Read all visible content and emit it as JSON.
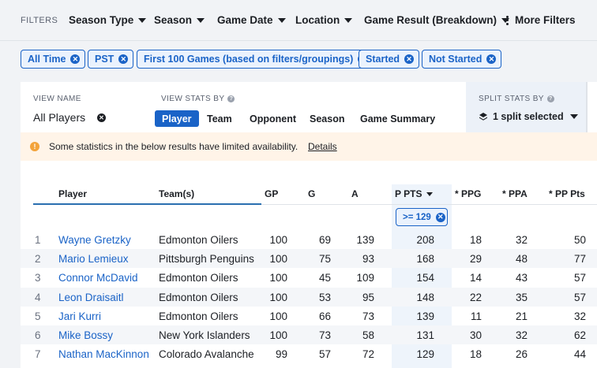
{
  "filterbar": {
    "label": "FILTERS",
    "dropdowns": [
      "Season Type",
      "Season",
      "Game Date",
      "Location",
      "Game Result (Breakdown)"
    ],
    "more": "More Filters"
  },
  "chips": [
    "All Time",
    "PST",
    "First 100 Games (based on filters/groupings)",
    "Started",
    "Not Started"
  ],
  "view": {
    "name_label": "VIEW NAME",
    "name": "All Players",
    "stats_label": "VIEW STATS BY",
    "tabs": [
      "Player",
      "Team",
      "Opponent",
      "Season",
      "Game Summary"
    ],
    "active_tab": "Player"
  },
  "split": {
    "label": "SPLIT STATS BY",
    "value": "1 split selected"
  },
  "notice": {
    "text": "Some statistics in the below results have limited availability.",
    "link": "Details"
  },
  "table": {
    "columns": [
      "Player",
      "Team(s)",
      "GP",
      "G",
      "A",
      "P PTS",
      "* PPG",
      "* PPA",
      "* PP Pts"
    ],
    "sort_column": "P PTS",
    "column_filter": ">= 129",
    "rows": [
      {
        "rank": "1",
        "player": "Wayne Gretzky",
        "team": "Edmonton Oilers",
        "gp": "100",
        "g": "69",
        "a": "139",
        "pts": "208",
        "ppg": "18",
        "ppa": "32",
        "pppts": "50"
      },
      {
        "rank": "2",
        "player": "Mario Lemieux",
        "team": "Pittsburgh Penguins",
        "gp": "100",
        "g": "75",
        "a": "93",
        "pts": "168",
        "ppg": "29",
        "ppa": "48",
        "pppts": "77"
      },
      {
        "rank": "3",
        "player": "Connor McDavid",
        "team": "Edmonton Oilers",
        "gp": "100",
        "g": "45",
        "a": "109",
        "pts": "154",
        "ppg": "14",
        "ppa": "43",
        "pppts": "57"
      },
      {
        "rank": "4",
        "player": "Leon Draisaitl",
        "team": "Edmonton Oilers",
        "gp": "100",
        "g": "53",
        "a": "95",
        "pts": "148",
        "ppg": "22",
        "ppa": "35",
        "pppts": "57"
      },
      {
        "rank": "5",
        "player": "Jari Kurri",
        "team": "Edmonton Oilers",
        "gp": "100",
        "g": "66",
        "a": "73",
        "pts": "139",
        "ppg": "11",
        "ppa": "21",
        "pppts": "32"
      },
      {
        "rank": "6",
        "player": "Mike Bossy",
        "team": "New York Islanders",
        "gp": "100",
        "g": "73",
        "a": "58",
        "pts": "131",
        "ppg": "30",
        "ppa": "32",
        "pppts": "62"
      },
      {
        "rank": "7",
        "player": "Nathan MacKinnon",
        "team": "Colorado Avalanche",
        "gp": "99",
        "g": "57",
        "a": "72",
        "pts": "129",
        "ppg": "18",
        "ppa": "26",
        "pppts": "44"
      }
    ]
  },
  "colors": {
    "accent": "#1a63c7",
    "notice_bg": "#fff4e8",
    "warn": "#f3a33b"
  }
}
